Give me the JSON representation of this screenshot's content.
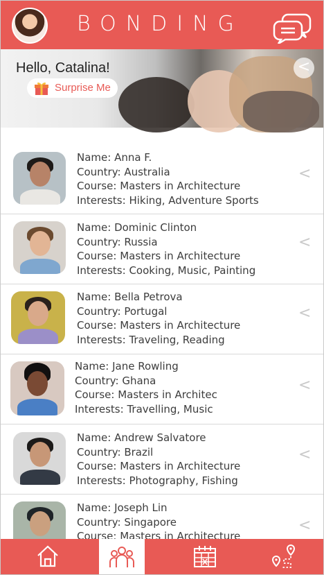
{
  "header": {
    "logo_text": "BONDING",
    "avatar": "user-avatar",
    "chat_icon": "chat-bubbles-icon"
  },
  "banner": {
    "greeting": "Hello, Catalina!",
    "surprise_label": "Surprise Me",
    "back_glyph": "<"
  },
  "list": [
    {
      "name": "Name: Anna F.",
      "country": "Country: Australia",
      "course": "Course: Masters in Architecture",
      "interests": "Interests: Hiking, Adventure Sports"
    },
    {
      "name": "Name: Dominic Clinton",
      "country": "Country: Russia",
      "course": "Course: Masters in Architecture",
      "interests": "Interests: Cooking, Music, Painting"
    },
    {
      "name": "Name: Bella Petrova",
      "country": "Country: Portugal",
      "course": "Course: Masters in Architecture",
      "interests": "Interests: Traveling, Reading"
    },
    {
      "name": "Name: Jane Rowling",
      "country": "Country: Ghana",
      "course": "Course: Masters in Architec",
      "interests": "Interests: Travelling, Music"
    },
    {
      "name": "Name: Andrew Salvatore",
      "country": "Country: Brazil",
      "course": "Course: Masters in Architecture",
      "interests": "Interests: Photography, Fishing"
    },
    {
      "name": "Name: Joseph Lin",
      "country": "Country: Singapore",
      "course": "Course: Masters in Architecture",
      "interests": ""
    }
  ],
  "chevron_glyph": "<",
  "nav": {
    "items": [
      "home-icon",
      "group-icon",
      "calendar-icon",
      "map-route-icon"
    ],
    "active": "group-icon"
  },
  "colors": {
    "accent": "#e85a55",
    "text": "#3c3c3c",
    "chevron": "#c9c9c9"
  }
}
